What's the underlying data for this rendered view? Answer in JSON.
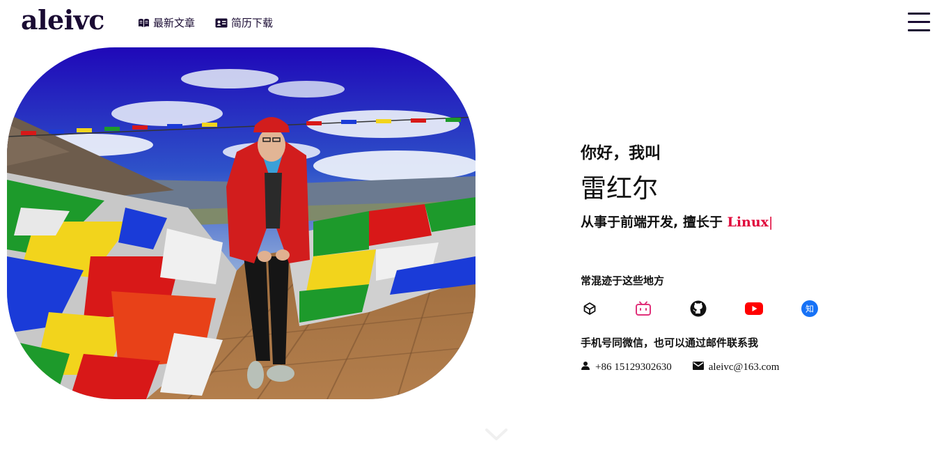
{
  "header": {
    "logo": "aleivc",
    "nav": [
      {
        "label": "最新文章",
        "icon": "book-icon"
      },
      {
        "label": "简历下载",
        "icon": "id-card-icon"
      }
    ],
    "menu_icon": "hamburger-menu-icon"
  },
  "hero": {
    "photo": "portrait-photo"
  },
  "intro": {
    "greeting": "你好，我叫",
    "name": "雷红尔",
    "role_prefix": "从事于前端开发, 擅长于",
    "skill": "Linux",
    "cursor": "|"
  },
  "socials": {
    "title": "常混迹于这些地方",
    "items": [
      {
        "name": "codepen-icon",
        "color": "#111111"
      },
      {
        "name": "bilibili-icon",
        "color": "#e0317a"
      },
      {
        "name": "github-icon",
        "color": "#111111"
      },
      {
        "name": "youtube-icon",
        "color": "#ff0000"
      },
      {
        "name": "zhihu-icon",
        "color": "#1772f6",
        "glyph": "知"
      }
    ]
  },
  "contact": {
    "title": "手机号同微信，也可以通过邮件联系我",
    "phone": "+86 15129302630",
    "email": "aleivc@163.com"
  },
  "colors": {
    "accent": "#e0073b",
    "logo": "#1a0b33"
  }
}
